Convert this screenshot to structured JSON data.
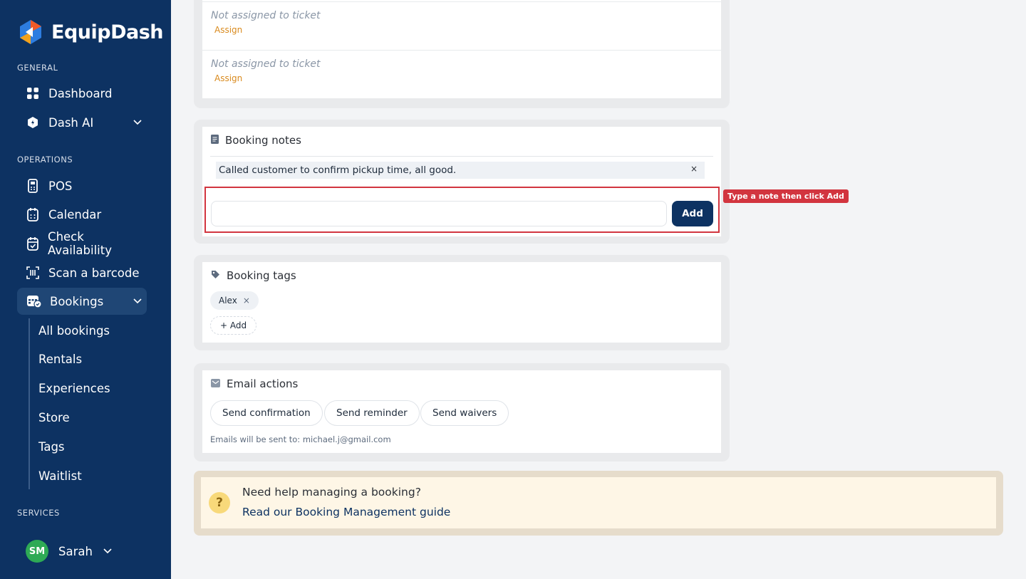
{
  "brand": {
    "name": "EquipDash",
    "colors": {
      "sidebar": "#0d3262",
      "accent": "#d98a1d",
      "highlight": "#d2353f"
    }
  },
  "sidebar": {
    "sections": {
      "general": "GENERAL",
      "operations": "OPERATIONS",
      "services": "SERVICES"
    },
    "items": {
      "dashboard": "Dashboard",
      "dash_ai": "Dash AI",
      "pos": "POS",
      "calendar": "Calendar",
      "check_availability": "Check Availability",
      "scan_barcode": "Scan a barcode",
      "bookings": "Bookings"
    },
    "sub_items": {
      "all_bookings": "All bookings",
      "rentals": "Rentals",
      "experiences": "Experiences",
      "store": "Store",
      "tags": "Tags",
      "waitlist": "Waitlist"
    },
    "user": {
      "initials": "SM",
      "name": "Sarah"
    }
  },
  "tickets": {
    "rows": [
      {
        "status": "Not assigned to ticket",
        "action": "Assign"
      },
      {
        "status": "Not assigned to ticket",
        "action": "Assign"
      }
    ]
  },
  "notes": {
    "title": "Booking notes",
    "existing": "Called customer to confirm pickup time, all good.",
    "remove_glyph": "×",
    "input_value": "",
    "add_label": "Add",
    "hint": "Type a note then click Add"
  },
  "tags": {
    "title": "Booking tags",
    "items": [
      {
        "label": "Alex",
        "remove": "×"
      }
    ],
    "add_label": "+ Add"
  },
  "email": {
    "title": "Email actions",
    "buttons": {
      "confirmation": "Send confirmation",
      "reminder": "Send reminder",
      "waivers": "Send waivers"
    },
    "note": "Emails will be sent to: michael.j@gmail.com"
  },
  "help": {
    "icon": "?",
    "question": "Need help managing a booking?",
    "link": "Read our Booking Management guide"
  }
}
